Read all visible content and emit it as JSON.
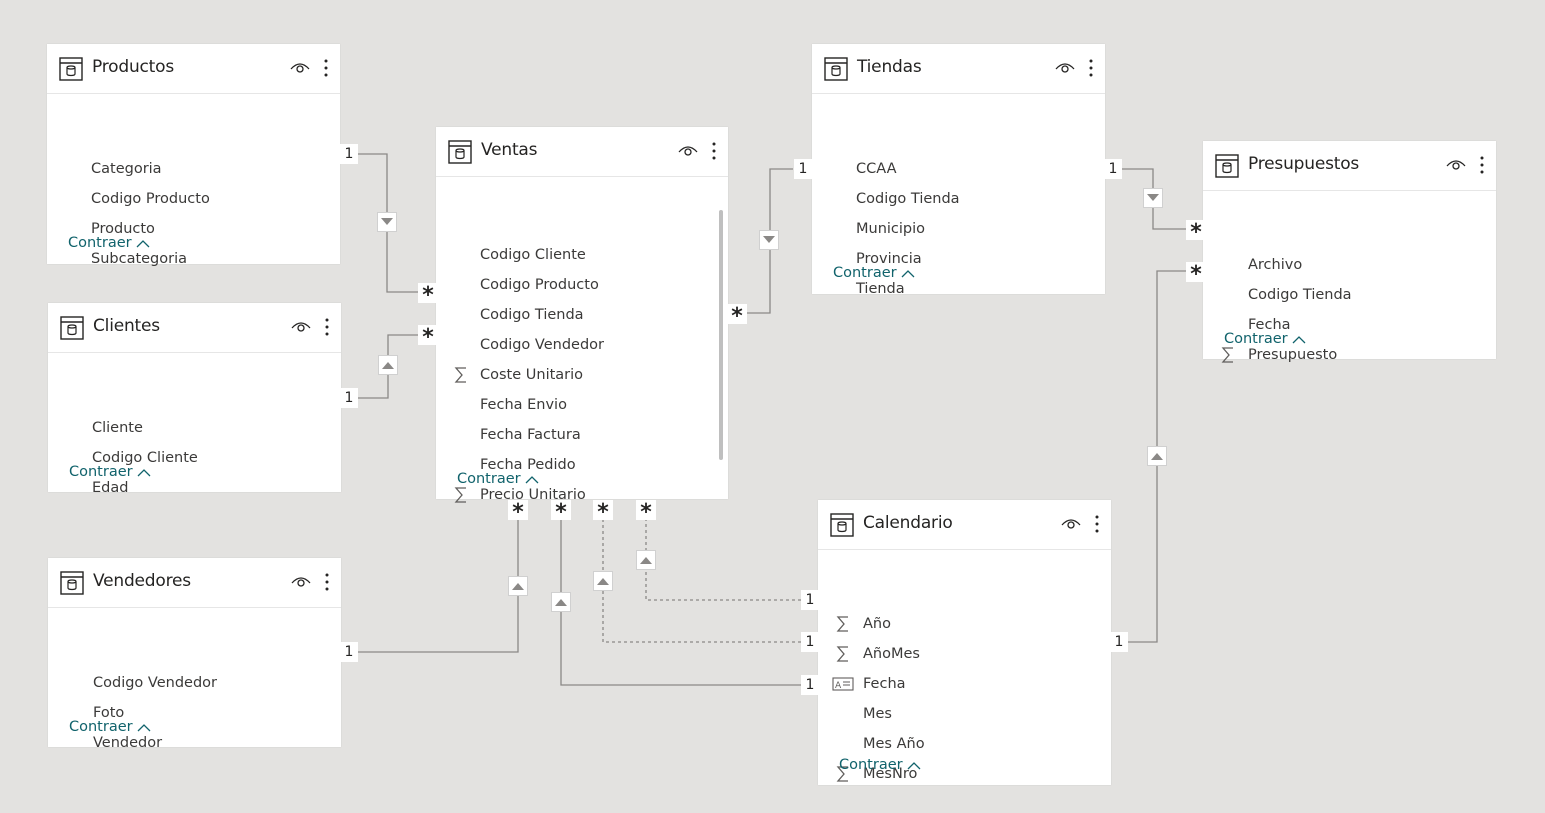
{
  "colors": {
    "background": "#e3e2e0",
    "card": "#ffffff",
    "link_text": "#11636c",
    "line": "#8a8886"
  },
  "collapse_label": "Contraer",
  "tables": {
    "productos": {
      "title": "Productos",
      "fields": [
        {
          "name": "Categoria",
          "icon": ""
        },
        {
          "name": "Codigo Producto",
          "icon": ""
        },
        {
          "name": "Producto",
          "icon": ""
        },
        {
          "name": "Subcategoria",
          "icon": ""
        }
      ]
    },
    "clientes": {
      "title": "Clientes",
      "fields": [
        {
          "name": "Cliente",
          "icon": ""
        },
        {
          "name": "Codigo Cliente",
          "icon": ""
        },
        {
          "name": "Edad",
          "icon": ""
        }
      ]
    },
    "vendedores": {
      "title": "Vendedores",
      "fields": [
        {
          "name": "Codigo Vendedor",
          "icon": ""
        },
        {
          "name": "Foto",
          "icon": ""
        },
        {
          "name": "Vendedor",
          "icon": ""
        }
      ]
    },
    "ventas": {
      "title": "Ventas",
      "fields": [
        {
          "name": "Codigo Cliente",
          "icon": ""
        },
        {
          "name": "Codigo Producto",
          "icon": ""
        },
        {
          "name": "Codigo Tienda",
          "icon": ""
        },
        {
          "name": "Codigo Vendedor",
          "icon": ""
        },
        {
          "name": "Coste Unitario",
          "icon": "sigma-icon"
        },
        {
          "name": "Fecha Envio",
          "icon": ""
        },
        {
          "name": "Fecha Factura",
          "icon": ""
        },
        {
          "name": "Fecha Pedido",
          "icon": ""
        },
        {
          "name": "Precio Unitario",
          "icon": "sigma-icon"
        }
      ]
    },
    "tiendas": {
      "title": "Tiendas",
      "fields": [
        {
          "name": "CCAA",
          "icon": ""
        },
        {
          "name": "Codigo Tienda",
          "icon": ""
        },
        {
          "name": "Municipio",
          "icon": ""
        },
        {
          "name": "Provincia",
          "icon": ""
        },
        {
          "name": "Tienda",
          "icon": ""
        }
      ]
    },
    "presupuestos": {
      "title": "Presupuestos",
      "fields": [
        {
          "name": "Archivo",
          "icon": ""
        },
        {
          "name": "Codigo Tienda",
          "icon": ""
        },
        {
          "name": "Fecha",
          "icon": ""
        },
        {
          "name": "Presupuesto",
          "icon": "sigma-icon"
        }
      ]
    },
    "calendario": {
      "title": "Calendario",
      "fields": [
        {
          "name": "Año",
          "icon": "sigma-icon"
        },
        {
          "name": "AñoMes",
          "icon": "sigma-icon"
        },
        {
          "name": "Fecha",
          "icon": "key-field-icon"
        },
        {
          "name": "Mes",
          "icon": ""
        },
        {
          "name": "Mes Año",
          "icon": ""
        },
        {
          "name": "MesNro",
          "icon": "sigma-icon"
        }
      ]
    }
  },
  "cardinality": {
    "one": "1",
    "many": "*"
  }
}
